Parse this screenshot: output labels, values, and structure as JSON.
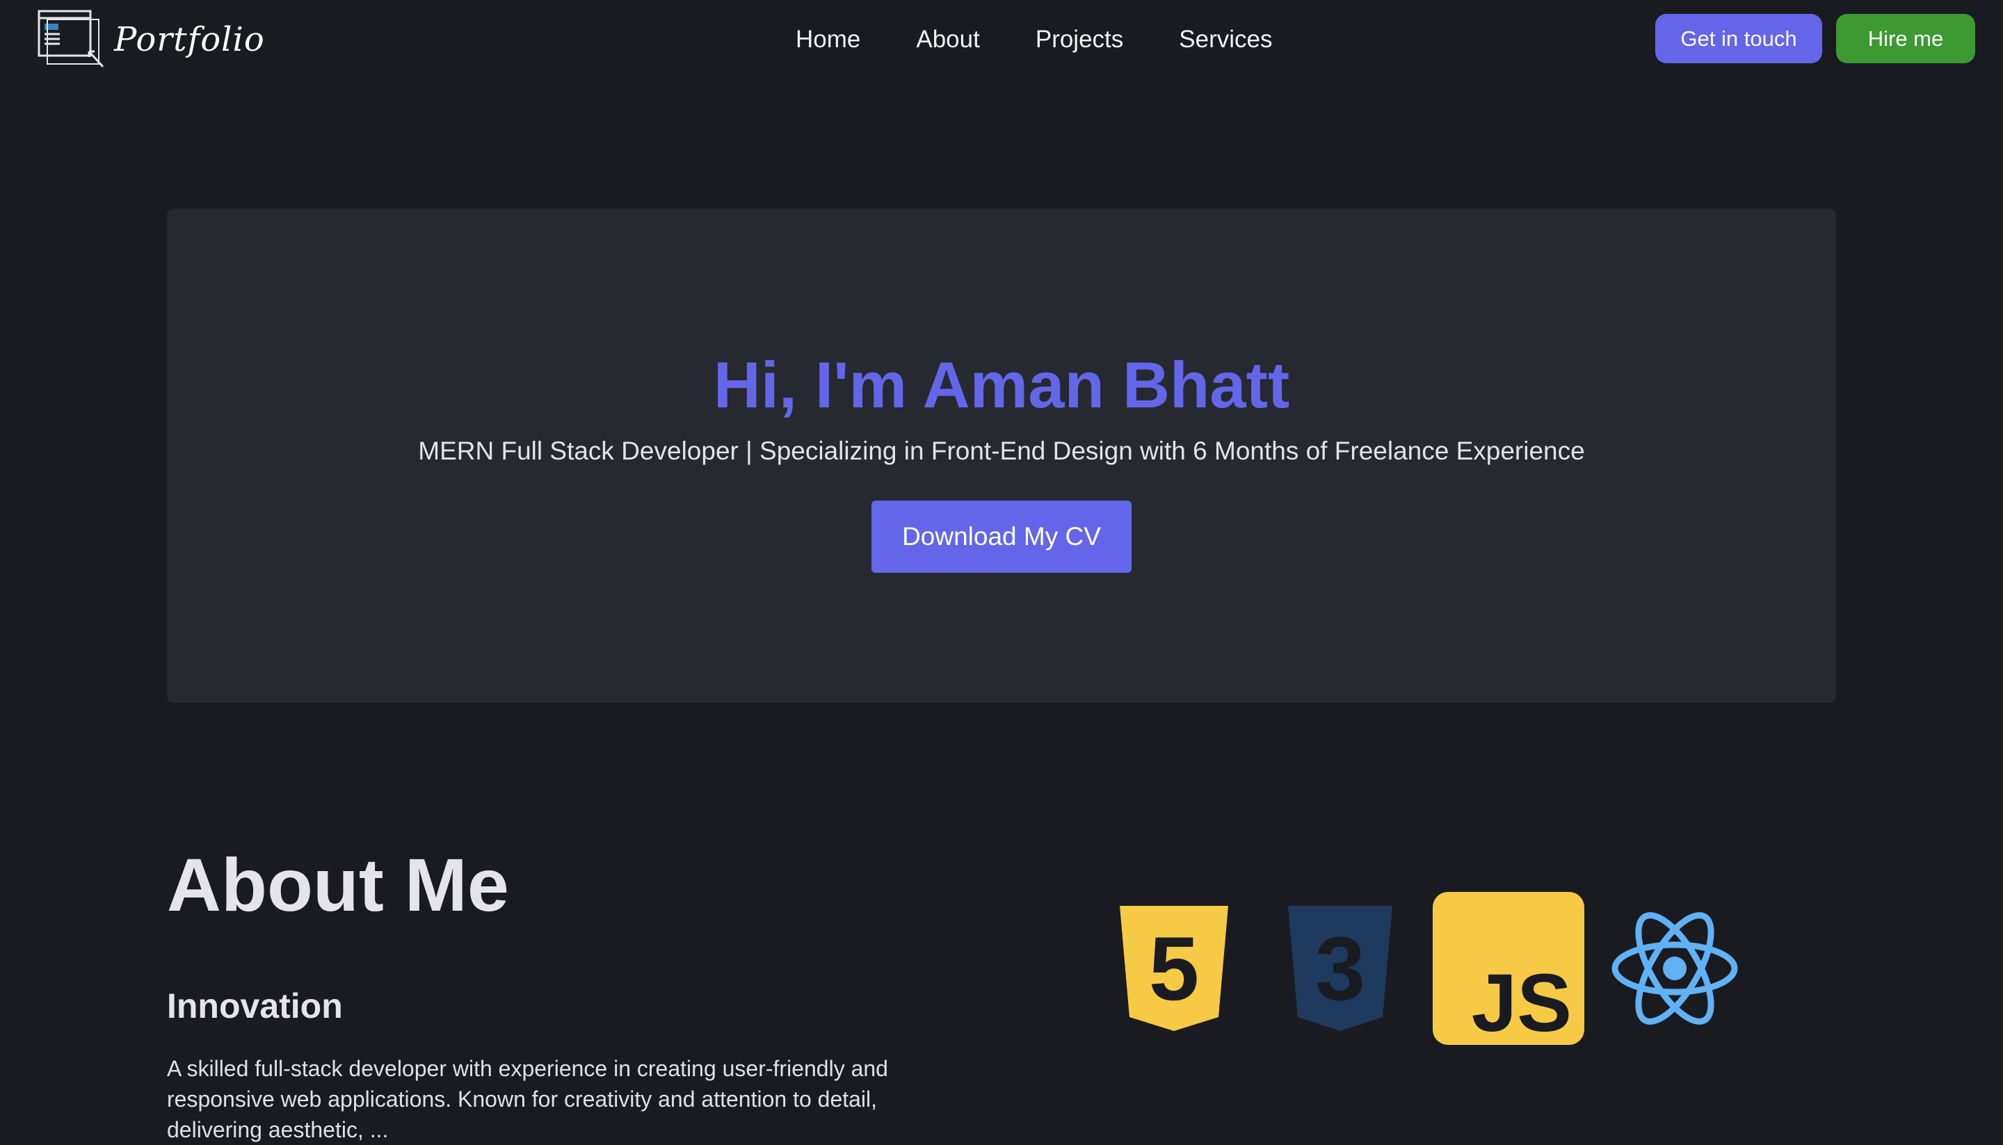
{
  "nav": {
    "brand": "Portfolio",
    "links": [
      "Home",
      "About",
      "Projects",
      "Services"
    ],
    "get_in_touch": "Get in touch",
    "hire_me": "Hire me"
  },
  "hero": {
    "title": "Hi, I'm Aman Bhatt",
    "subtitle": "MERN Full Stack Developer | Specializing in Front-End Design with 6 Months of Freelance Experience",
    "cv_button": "Download My CV"
  },
  "about": {
    "title": "About Me",
    "subheading": "Innovation",
    "text": "A skilled full-stack developer with experience in creating user-friendly and responsive web applications. Known for creativity and attention to detail, delivering aesthetic, ..."
  },
  "tech_icons": [
    {
      "icon": "html5-icon",
      "label": "5"
    },
    {
      "icon": "css3-icon",
      "label": "3"
    },
    {
      "icon": "javascript-icon",
      "label": "JS"
    },
    {
      "icon": "react-icon"
    }
  ],
  "colors": {
    "background": "#1a1b20",
    "card": "#272931",
    "accent": "#6366e8",
    "hire": "#3d9a33",
    "js_yellow": "#f7ca45",
    "css_blue": "#1f3a5f",
    "react_blue": "#61b1f5"
  }
}
